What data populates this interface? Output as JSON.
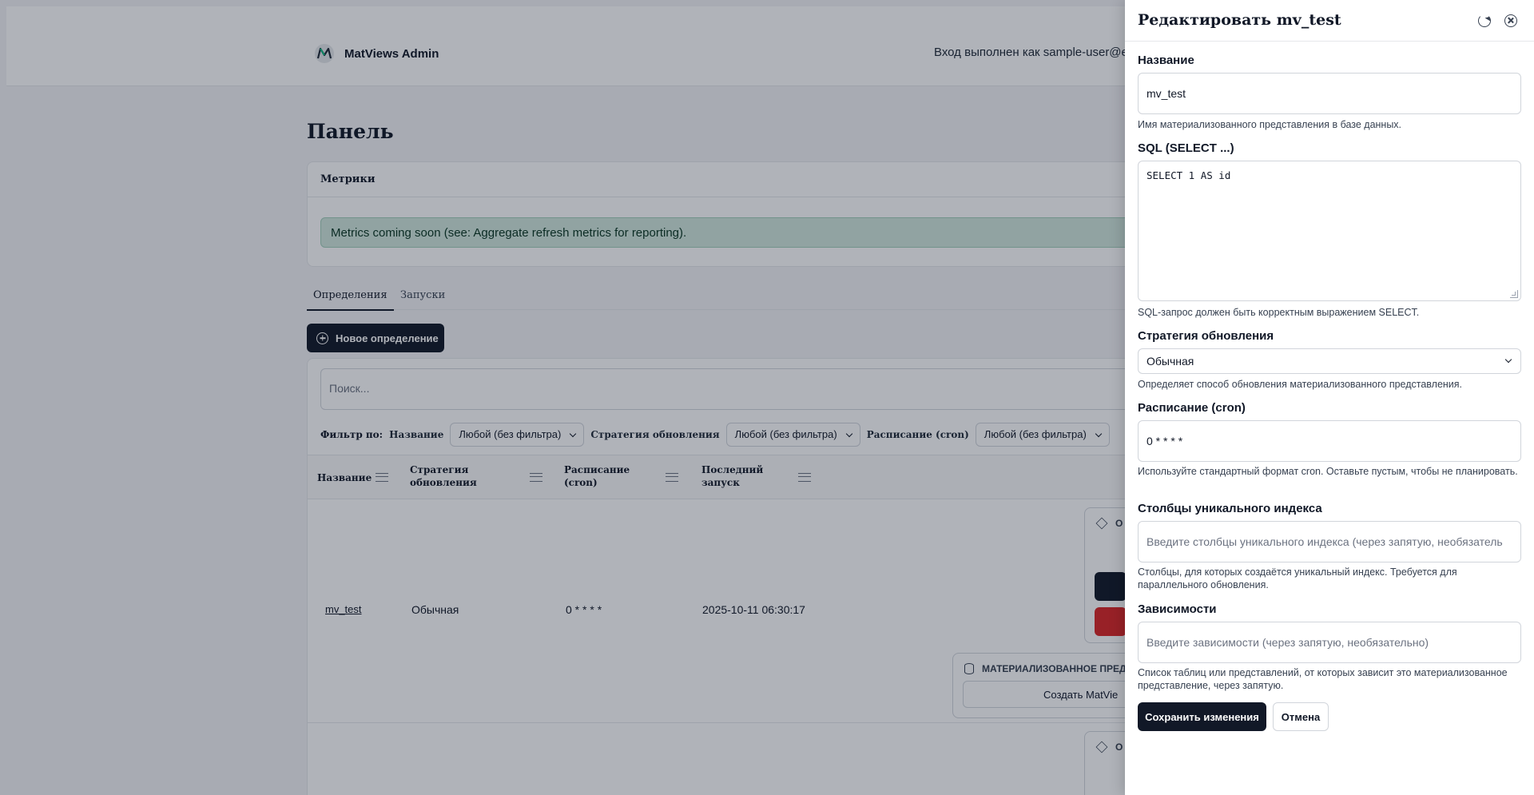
{
  "app": {
    "brand_name": "MatViews Admin",
    "login_text": "Вход выполнен как sample-user@e"
  },
  "dashboard": {
    "title": "Панель",
    "metrics": {
      "header": "Метрики",
      "alert": "Metrics coming soon (see: Aggregate refresh metrics for reporting)."
    },
    "tabs": [
      {
        "label": "Определения",
        "active": true
      },
      {
        "label": "Запуски",
        "active": false
      }
    ],
    "new_button": "Новое определение",
    "search_placeholder": "Поиск...",
    "filter": {
      "label": "Фильтр по:",
      "fields": [
        {
          "name": "Название",
          "value": "Любой (без фильтра)"
        },
        {
          "name": "Стратегия обновления",
          "value": "Любой (без фильтра)"
        },
        {
          "name": "Расписание (cron)",
          "value": "Любой (без фильтра)"
        }
      ]
    },
    "table": {
      "columns": [
        "Название",
        "Стратегия обновления",
        "Расписание (cron)",
        "Последний запуск"
      ],
      "rows": [
        {
          "name": "mv_test",
          "strategy": "Обычная",
          "schedule": "0 * * * *",
          "last_run": "2025-10-11 06:30:17"
        }
      ],
      "mat_card_title": "МАТЕРИАЛИЗОВАННОЕ ПРЕД",
      "mat_card_button": "Создать MatVie",
      "card_label": "O"
    }
  },
  "drawer": {
    "title": "Редактировать mv_test",
    "fields": {
      "name": {
        "label": "Название",
        "value": "mv_test",
        "help": "Имя материализованного представления в базе данных."
      },
      "sql": {
        "label": "SQL (SELECT ...)",
        "value": "SELECT 1 AS id",
        "help": "SQL-запрос должен быть корректным выражением SELECT."
      },
      "strategy": {
        "label": "Стратегия обновления",
        "value": "Обычная",
        "help": "Определяет способ обновления материализованного представления."
      },
      "schedule": {
        "label": "Расписание (cron)",
        "value": "0 * * * *",
        "help": "Используйте стандартный формат cron. Оставьте пустым, чтобы не планировать."
      },
      "unique_index": {
        "label": "Столбцы уникального индекса",
        "placeholder": "Введите столбцы уникального индекса (через запятую, необязатель",
        "help": "Столбцы, для которых создаётся уникальный индекс. Требуется для параллельного обновления."
      },
      "dependencies": {
        "label": "Зависимости",
        "placeholder": "Введите зависимости (через запятую, необязательно)",
        "help": "Список таблиц или представлений, от которых зависит это материализованное представление, через запятую."
      }
    },
    "save_button": "Сохранить изменения",
    "cancel_button": "Отмена"
  },
  "colors": {
    "primary": "#111827",
    "alert_bg": "#d1e7dd",
    "danger": "#dc2626"
  }
}
